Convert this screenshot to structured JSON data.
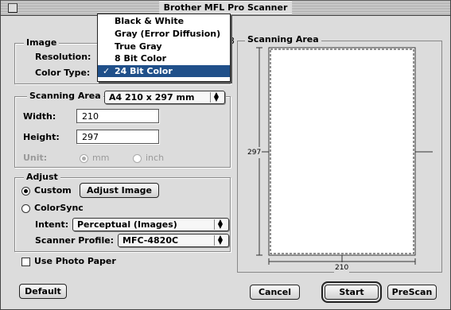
{
  "window": {
    "title": "Brother MFL Pro Scanner"
  },
  "image_group": {
    "legend": "Image",
    "resolution_label": "Resolution:",
    "color_type_label": "Color Type:",
    "partial_char": "3"
  },
  "color_menu": {
    "items": [
      "Black & White",
      "Gray (Error Diffusion)",
      "True Gray",
      "8 Bit Color",
      "24 Bit Color"
    ],
    "selected_index": 4,
    "check_glyph": "✓"
  },
  "scanning_area_group": {
    "legend": "Scanning Area",
    "size_select": "A4 210 x 297 mm",
    "width_label": "Width:",
    "width_value": "210",
    "height_label": "Height:",
    "height_value": "297",
    "unit_label": "Unit:",
    "unit_mm": "mm",
    "unit_inch": "inch",
    "unit_selected": "mm"
  },
  "adjust_group": {
    "legend": "Adjust",
    "custom_label": "Custom",
    "adjust_image_button": "Adjust Image",
    "colorsync_label": "ColorSync",
    "intent_label": "Intent:",
    "intent_value": "Perceptual (Images)",
    "scanner_profile_label": "Scanner Profile:",
    "scanner_profile_value": "MFC-4820C",
    "mode_selected": "Custom"
  },
  "use_photo_paper": {
    "label": "Use Photo Paper",
    "checked": false
  },
  "preview": {
    "legend": "Scanning Area",
    "height_dim": "297",
    "width_dim": "210"
  },
  "buttons": {
    "default": "Default",
    "cancel": "Cancel",
    "start": "Start",
    "prescan": "PreScan"
  },
  "colors": {
    "menu_highlight": "#20508a",
    "window_bg": "#dcdcdc"
  }
}
